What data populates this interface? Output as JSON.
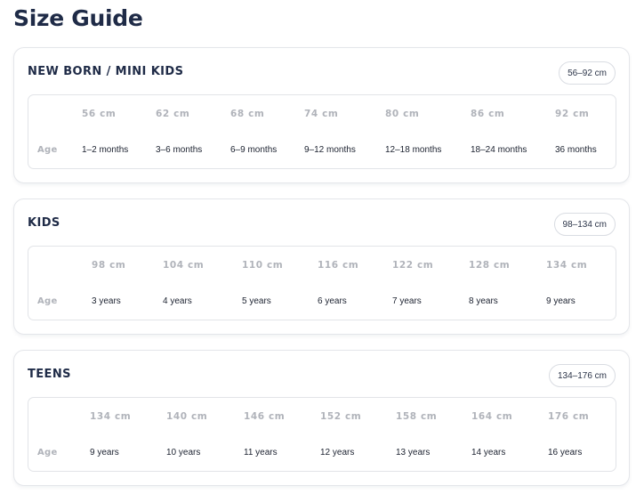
{
  "page_title": "Size Guide",
  "sections": [
    {
      "title": "NEW BORN / MINI KIDS",
      "range": "56–92 cm",
      "row_label": "Age",
      "columns": [
        {
          "size": "56 cm",
          "age": "1–2 months"
        },
        {
          "size": "62 cm",
          "age": "3–6 months"
        },
        {
          "size": "68 cm",
          "age": "6–9 months"
        },
        {
          "size": "74 cm",
          "age": "9–12 months"
        },
        {
          "size": "80 cm",
          "age": "12–18 months"
        },
        {
          "size": "86 cm",
          "age": "18–24 months"
        },
        {
          "size": "92 cm",
          "age": "36 months"
        }
      ]
    },
    {
      "title": "KIDS",
      "range": "98–134 cm",
      "row_label": "Age",
      "columns": [
        {
          "size": "98 cm",
          "age": "3 years"
        },
        {
          "size": "104 cm",
          "age": "4 years"
        },
        {
          "size": "110 cm",
          "age": "5 years"
        },
        {
          "size": "116 cm",
          "age": "6 years"
        },
        {
          "size": "122 cm",
          "age": "7 years"
        },
        {
          "size": "128 cm",
          "age": "8 years"
        },
        {
          "size": "134 cm",
          "age": "9 years"
        }
      ]
    },
    {
      "title": "TEENS",
      "range": "134–176 cm",
      "row_label": "Age",
      "columns": [
        {
          "size": "134 cm",
          "age": "9 years"
        },
        {
          "size": "140 cm",
          "age": "10 years"
        },
        {
          "size": "146 cm",
          "age": "11 years"
        },
        {
          "size": "152 cm",
          "age": "12 years"
        },
        {
          "size": "158 cm",
          "age": "13 years"
        },
        {
          "size": "164 cm",
          "age": "14 years"
        },
        {
          "size": "176 cm",
          "age": "16 years"
        }
      ]
    }
  ]
}
